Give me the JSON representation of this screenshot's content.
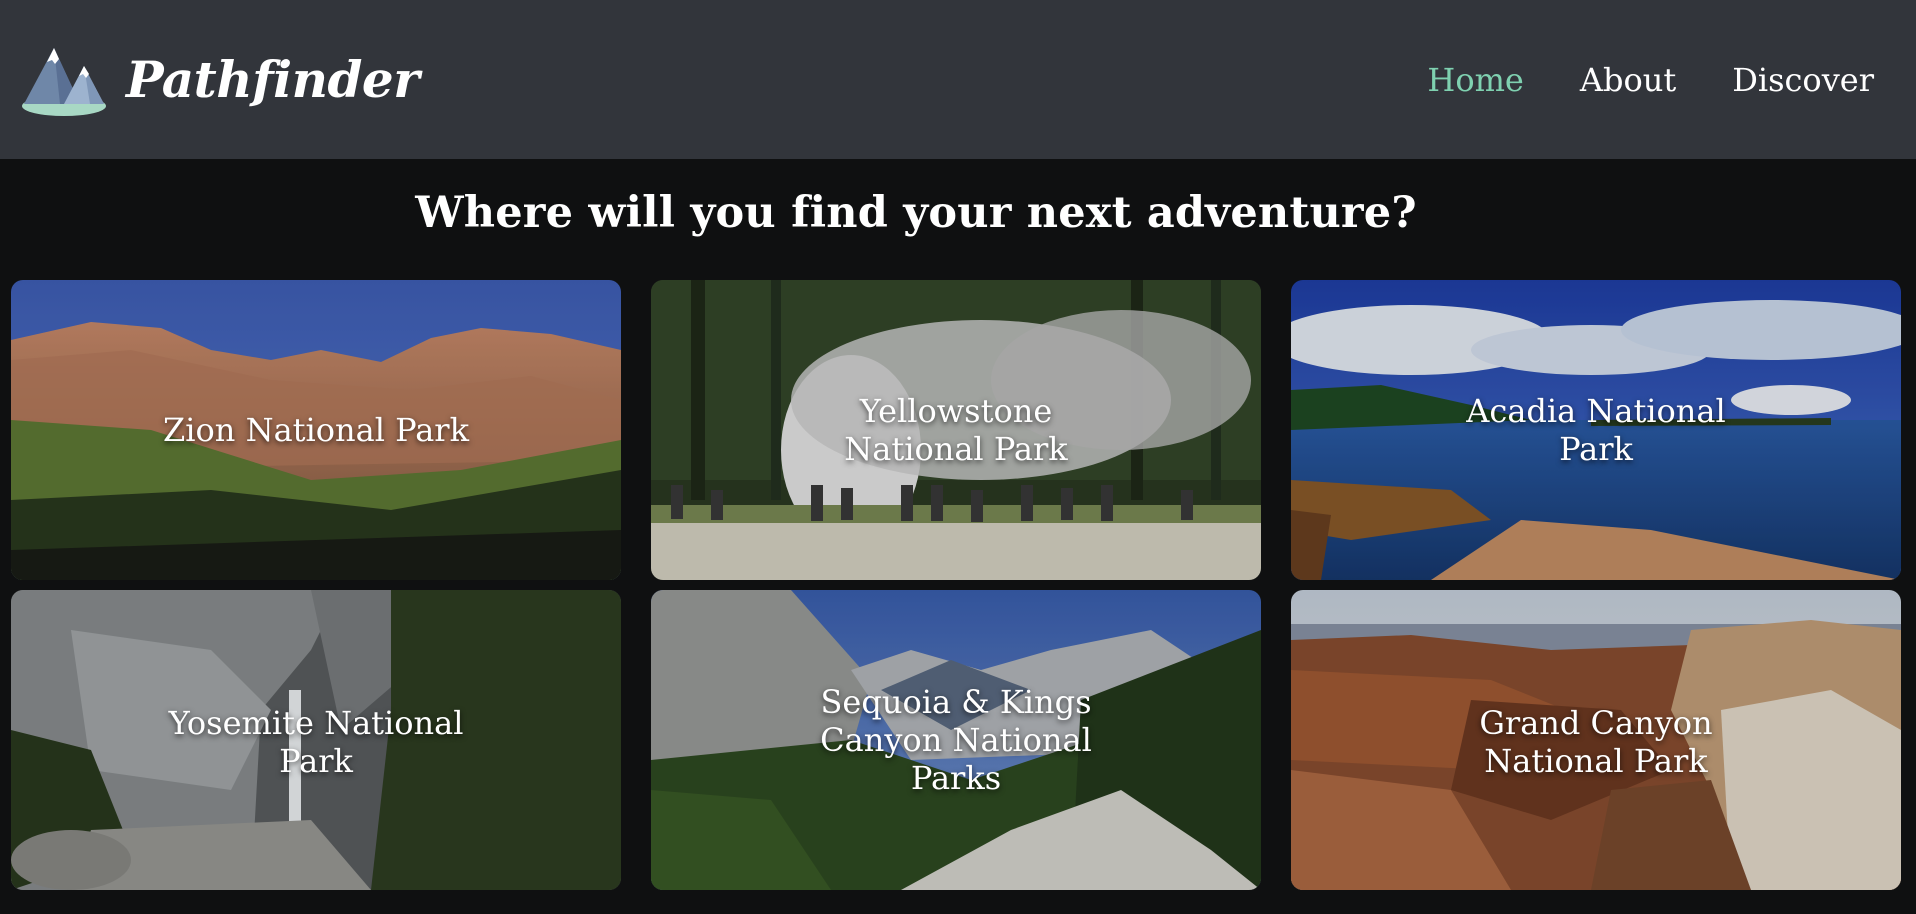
{
  "brand": {
    "name": "Pathfinder",
    "logo_icon": "mountain-logo-icon"
  },
  "nav": {
    "items": [
      {
        "label": "Home",
        "active": true
      },
      {
        "label": "About",
        "active": false
      },
      {
        "label": "Discover",
        "active": false
      }
    ]
  },
  "headline": "Where will you find your next adventure?",
  "parks": [
    {
      "name": "Zion National Park"
    },
    {
      "name": "Yellowstone National Park"
    },
    {
      "name": "Acadia National Park"
    },
    {
      "name": "Yosemite National Park"
    },
    {
      "name": "Sequoia & Kings Canyon National Parks"
    },
    {
      "name": "Grand Canyon National Park"
    }
  ],
  "colors": {
    "navbar_bg": "#32353b",
    "page_bg": "#0f1011",
    "active_link": "#7fd1b0",
    "text": "#ffffff"
  }
}
